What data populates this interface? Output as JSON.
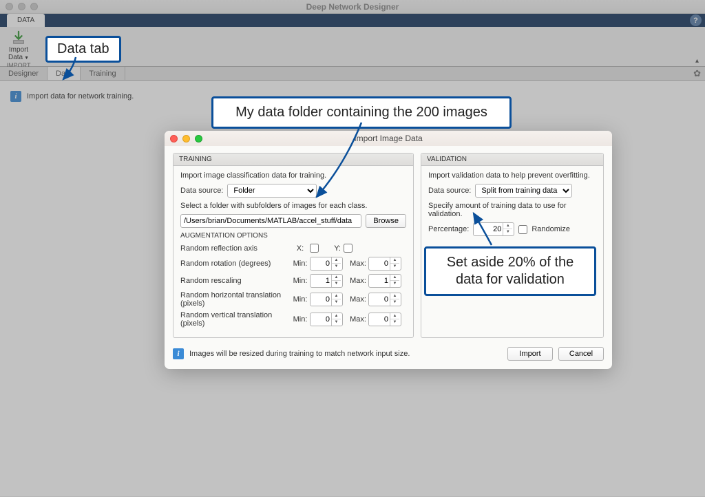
{
  "window": {
    "title": "Deep Network Designer"
  },
  "ribbon": {
    "tab": "DATA"
  },
  "toolstrip": {
    "import_label1": "Import",
    "import_label2": "Data",
    "group_label": "IMPORT"
  },
  "doc_tabs": {
    "designer": "Designer",
    "data": "Data",
    "training": "Training"
  },
  "content": {
    "info": "Import data for network training."
  },
  "dialog": {
    "title": "Import Image Data",
    "training": {
      "header": "TRAINING",
      "intro": "Import image classification data for training.",
      "data_source_label": "Data source:",
      "data_source_value": "Folder",
      "select_folder_label": "Select a folder with subfolders of images for each class.",
      "path": "/Users/brian/Documents/MATLAB/accel_stuff/data",
      "browse": "Browse",
      "aug_header": "AUGMENTATION OPTIONS",
      "reflect_label": "Random reflection axis",
      "x_label": "X:",
      "y_label": "Y:",
      "min": "Min:",
      "max": "Max:",
      "rotation": "Random rotation (degrees)",
      "rotation_min": "0",
      "rotation_max": "0",
      "rescaling": "Random rescaling",
      "rescaling_min": "1",
      "rescaling_max": "1",
      "htrans": "Random horizontal translation (pixels)",
      "htrans_min": "0",
      "htrans_max": "0",
      "vtrans": "Random vertical translation (pixels)",
      "vtrans_min": "0",
      "vtrans_max": "0"
    },
    "validation": {
      "header": "VALIDATION",
      "intro": "Import validation data to help prevent overfitting.",
      "data_source_label": "Data source:",
      "data_source_value": "Split from training data",
      "specify": "Specify amount of training data to use for validation.",
      "pct_label": "Percentage:",
      "pct_value": "20",
      "randomize": "Randomize"
    },
    "footer": {
      "note": "Images will be resized during training to match network input size.",
      "import": "Import",
      "cancel": "Cancel"
    }
  },
  "callouts": {
    "data_tab": "Data tab",
    "folder": "My data folder containing the 200 images",
    "validation": "Set aside 20% of the data for validation"
  }
}
